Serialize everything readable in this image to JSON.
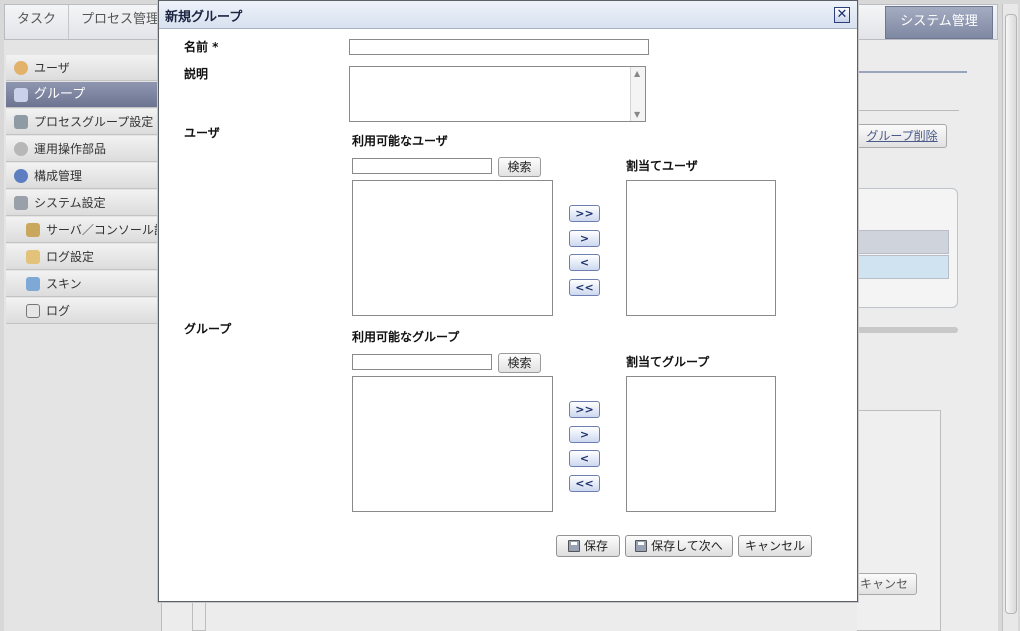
{
  "top_tabs": [
    {
      "label": "タスク"
    },
    {
      "label": "プロセス管理"
    },
    {
      "label": "システム管理"
    }
  ],
  "sidebar": {
    "items": [
      {
        "label": "ユーザ",
        "icon": "user-icon"
      },
      {
        "label": "グループ",
        "icon": "group-icon"
      },
      {
        "label": "プロセスグループ設定",
        "icon": "tools-icon"
      },
      {
        "label": "運用操作部品",
        "icon": "gear-icon"
      },
      {
        "label": "構成管理",
        "icon": "config-icon"
      },
      {
        "label": "システム設定",
        "icon": "settings-icon"
      },
      {
        "label": "サーバ／コンソール設定",
        "icon": "server-icon"
      },
      {
        "label": "ログ設定",
        "icon": "log-settings-icon"
      },
      {
        "label": "スキン",
        "icon": "skin-icon"
      },
      {
        "label": "ログ",
        "icon": "log-icon"
      }
    ]
  },
  "background": {
    "group_delete_button": "グループ削除",
    "cancel_button": "キャンセル"
  },
  "dialog": {
    "title": "新規グループ",
    "close_icon": "close-icon",
    "fields": {
      "name_label": "名前 *",
      "name_value": "",
      "description_label": "説明",
      "description_value": "",
      "users_label": "ユーザ",
      "groups_label": "グループ"
    },
    "users": {
      "available_title": "利用可能なユーザ",
      "search_value": "",
      "search_button": "検索",
      "assigned_title": "割当てユーザ",
      "available_items": [],
      "assigned_items": []
    },
    "groups": {
      "available_title": "利用可能なグループ",
      "search_value": "",
      "search_button": "検索",
      "assigned_title": "割当てグループ",
      "available_items": [],
      "assigned_items": []
    },
    "transfer_buttons": {
      "add_all": ">>",
      "add": ">",
      "remove": "<",
      "remove_all": "<<"
    },
    "footer": {
      "save": "保存",
      "save_next": "保存して次へ",
      "cancel": "キャンセル"
    }
  }
}
